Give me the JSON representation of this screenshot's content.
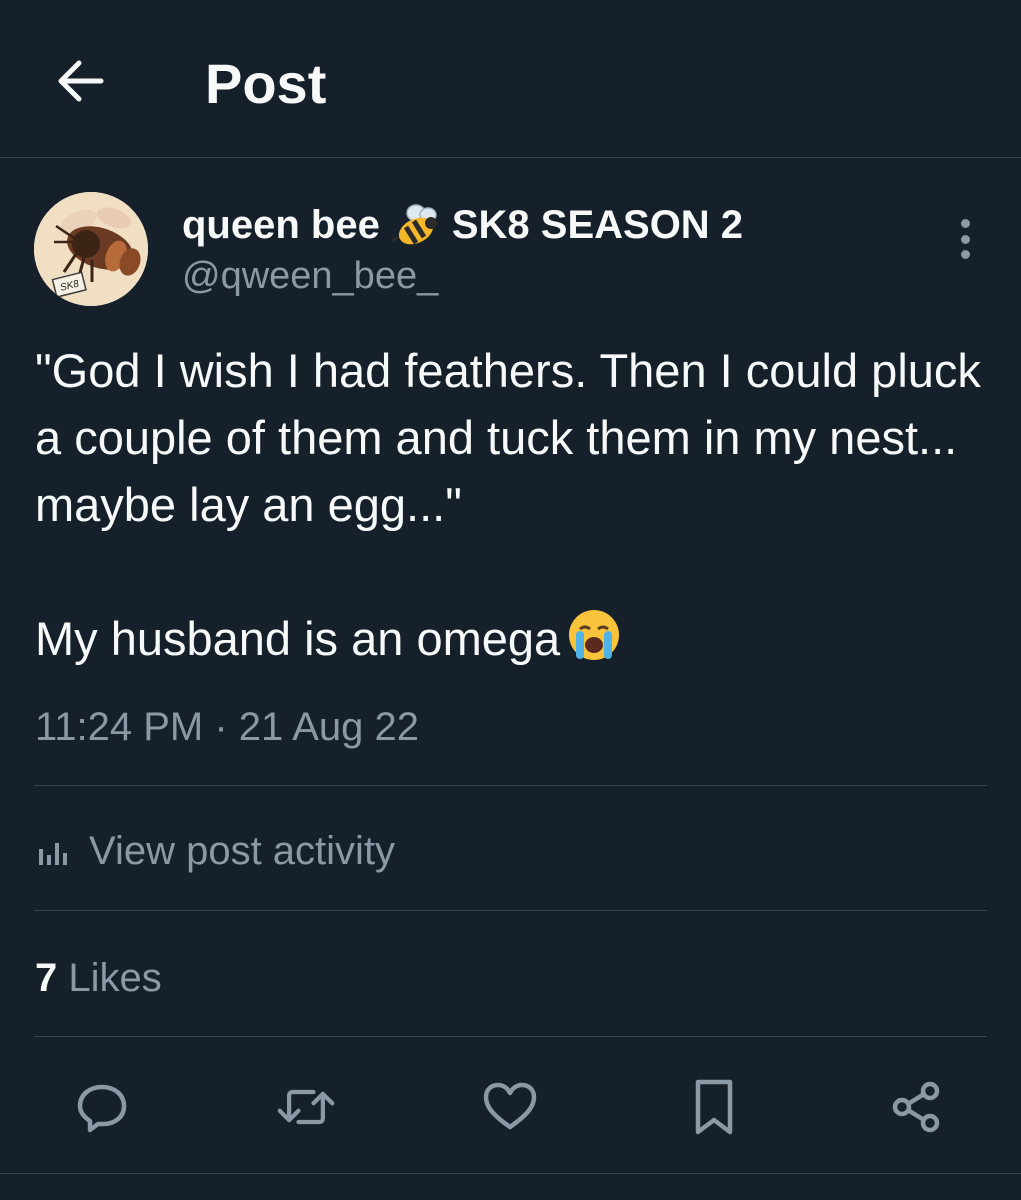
{
  "header": {
    "back_icon": "arrow-left-icon",
    "title": "Post"
  },
  "post": {
    "author": {
      "display_name": "queen bee",
      "name_emoji": "honeybee-emoji",
      "name_suffix": "SK8 SEASON 2",
      "handle": "@qween_bee_",
      "avatar_label": "SK8"
    },
    "text_lines": [
      "\"God I wish I had feathers. Then I could pluck a couple of them and tuck them in my nest... maybe lay an egg...\"",
      "My husband is an omega"
    ],
    "text_emoji": "loudly-crying-face-emoji",
    "timestamp": "11:24 PM · 21 Aug 22",
    "activity_label": "View post activity",
    "likes_count": "7",
    "likes_label": "Likes"
  },
  "actions": [
    {
      "icon": "reply-icon"
    },
    {
      "icon": "repost-icon"
    },
    {
      "icon": "like-icon"
    },
    {
      "icon": "bookmark-icon"
    },
    {
      "icon": "share-icon"
    }
  ],
  "colors": {
    "background": "#15202b",
    "text_primary": "#f7f9f9",
    "text_secondary": "#8b98a5",
    "divider": "#38444d"
  }
}
